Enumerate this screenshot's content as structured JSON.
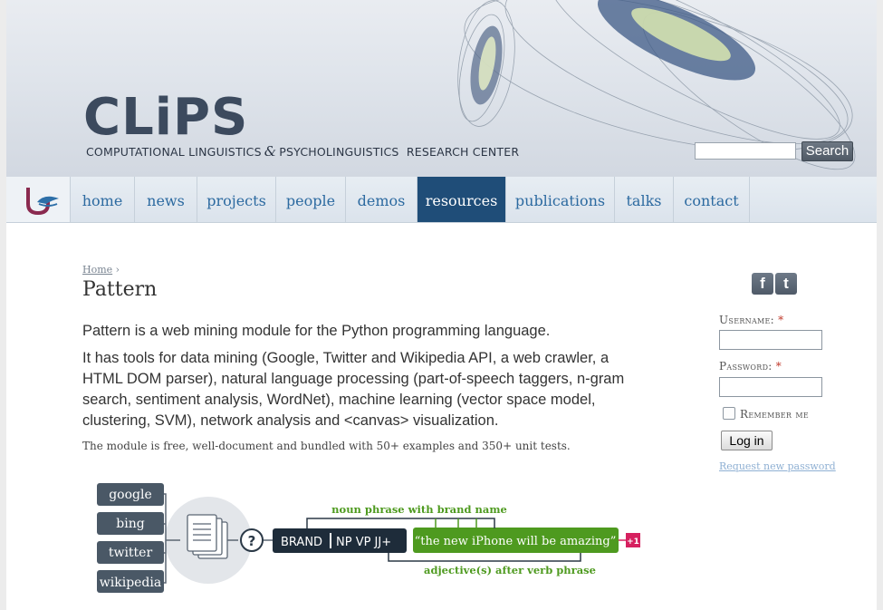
{
  "header": {
    "logo_text": "CLiPS",
    "subtitle_left": "COMPUTATIONAL LINGUISTICS",
    "subtitle_amp": "&",
    "subtitle_right": "PSYCHOLINGUISTICS  RESEARCH CENTER",
    "search_placeholder": "",
    "search_value": "",
    "search_button": "Search"
  },
  "nav": {
    "items": [
      {
        "label": "home",
        "active": false
      },
      {
        "label": "news",
        "active": false
      },
      {
        "label": "projects",
        "active": false
      },
      {
        "label": "people",
        "active": false
      },
      {
        "label": "demos",
        "active": false
      },
      {
        "label": "resources",
        "active": true
      },
      {
        "label": "publications",
        "active": false
      },
      {
        "label": "talks",
        "active": false
      },
      {
        "label": "contact",
        "active": false
      }
    ]
  },
  "main": {
    "breadcrumb_home": "Home",
    "breadcrumb_sep": "›",
    "title": "Pattern",
    "para1": "Pattern is a web mining module for the Python programming language.",
    "para2": "It has tools for data mining (Google, Twitter and Wikipedia API, a web crawler, a HTML DOM parser), natural language processing (part-of-speech taggers, n-gram search, sentiment analysis, WordNet), machine learning (vector space model, clustering, SVM), network analysis and <canvas> visualization.",
    "para3": "The module is free, well-document and bundled with 50+ examples and 350+ unit tests."
  },
  "diagram": {
    "sources": [
      "google",
      "bing",
      "twitter",
      "wikipedia"
    ],
    "question": "?",
    "tag_brand": "BRAND",
    "tag_rest": "NP VP JJ+",
    "quote": "“the new iPhone will be amazing”",
    "score": "+1",
    "top_label": "noun phrase with brand name",
    "bottom_label": "adjective(s) after verb phrase",
    "colors": {
      "dark": "#2b3947",
      "green": "#4e9a1f",
      "pink": "#d6205f",
      "gray_circle": "#e3e6ea"
    }
  },
  "sidebar": {
    "social": [
      "f",
      "t"
    ],
    "username_label": "Username:",
    "password_label": "Password:",
    "required_mark": "*",
    "remember_label": "Remember me",
    "login_button": "Log in",
    "request_link": "Request new password"
  }
}
